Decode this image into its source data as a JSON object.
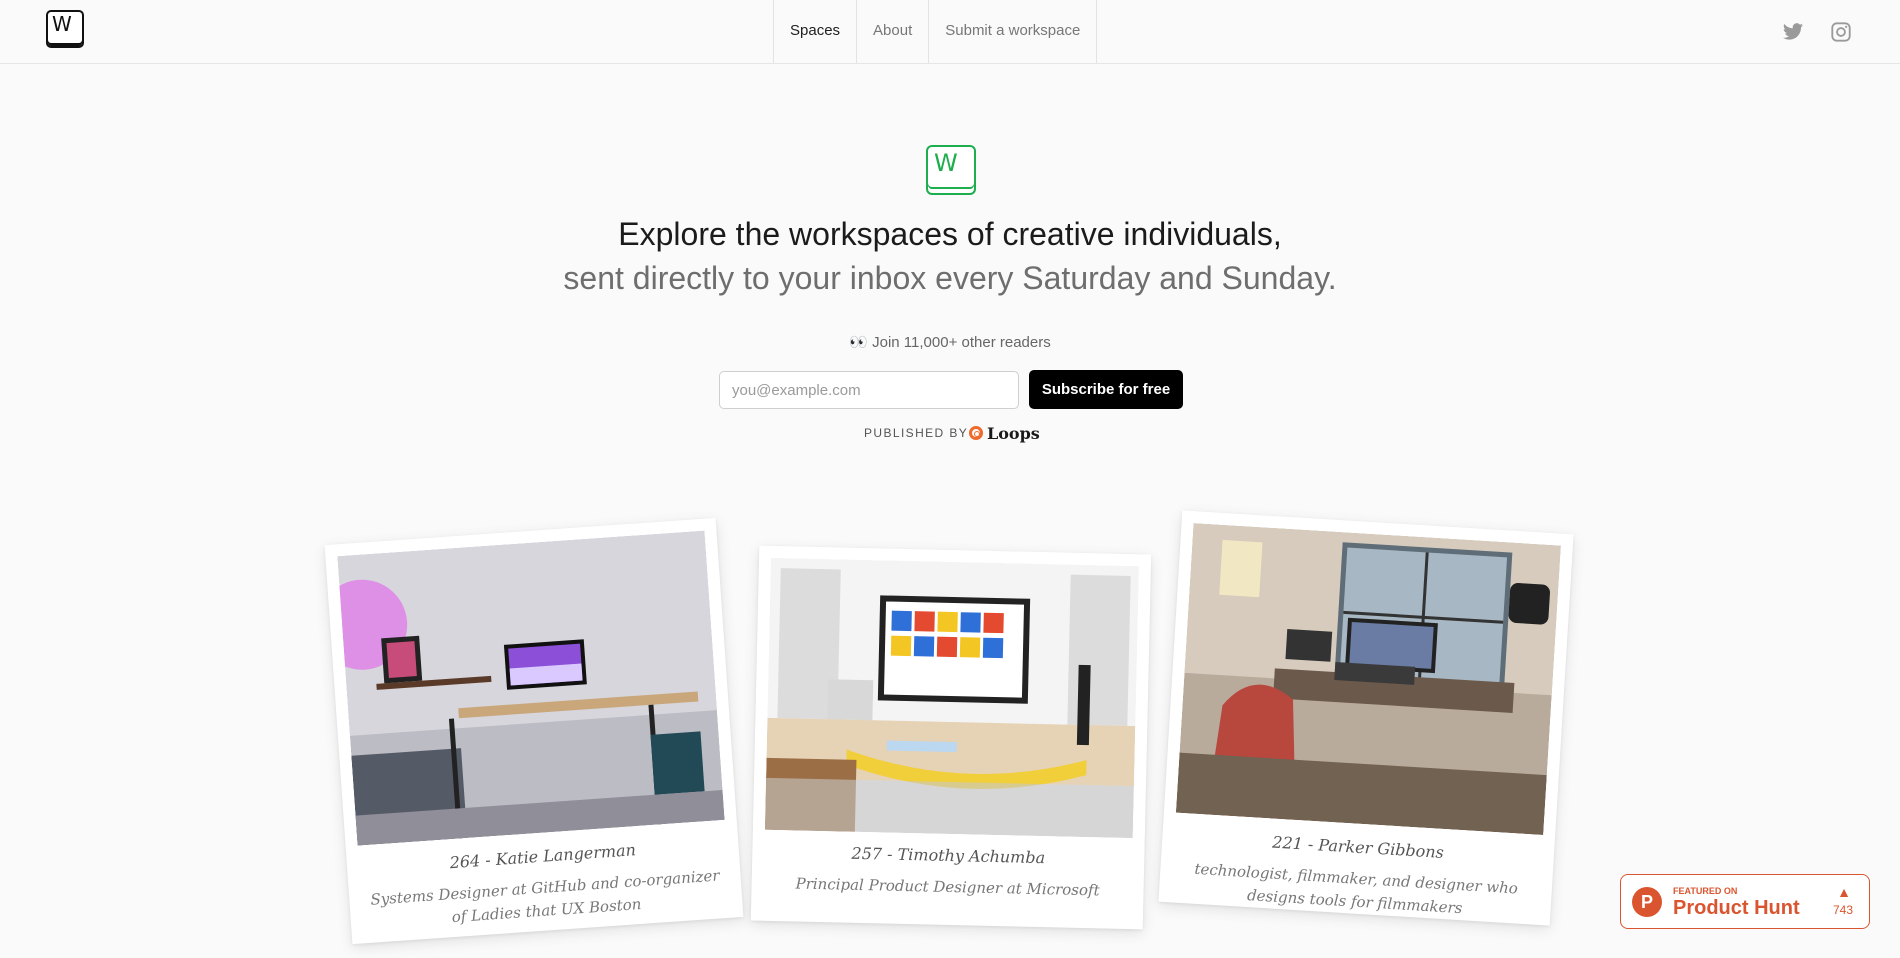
{
  "nav": {
    "logo_letter": "W",
    "links": [
      "Spaces",
      "About",
      "Submit a workspace"
    ],
    "social": [
      "twitter-icon",
      "instagram-icon"
    ]
  },
  "hero": {
    "logo_letter": "W",
    "headline": "Explore the workspaces of creative individuals,",
    "subline": "sent directly to your inbox every Saturday and Sunday.",
    "readers_emoji": "👀",
    "readers_text": "Join 11,000+ other readers",
    "email_placeholder": "you@example.com",
    "subscribe_label": "Subscribe for free",
    "published_by": "PUBLISHED BY",
    "publisher": "Loops"
  },
  "cards": [
    {
      "title": "264 - Katie Langerman",
      "description": "Systems Designer at GitHub and co-organizer of Ladies that UX Boston"
    },
    {
      "title": "257 - Timothy Achumba",
      "description": "Principal Product Designer at Microsoft"
    },
    {
      "title": "221 - Parker Gibbons",
      "description": "technologist, filmmaker, and designer who designs tools for filmmakers"
    }
  ],
  "product_hunt": {
    "featured": "FEATURED ON",
    "brand": "Product Hunt",
    "votes": "743",
    "color": "#da552f"
  },
  "colors": {
    "accent_green": "#1fae4e",
    "background": "#fafafa",
    "button": "#000000"
  }
}
